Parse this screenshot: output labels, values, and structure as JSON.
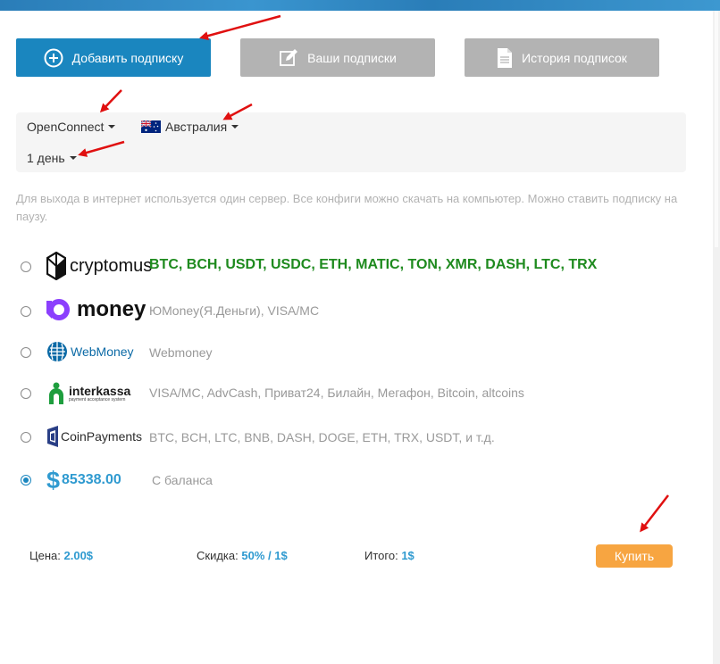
{
  "tabs": {
    "add_label": "Добавить подписку",
    "subs_label": "Ваши подписки",
    "history_label": "История подписок"
  },
  "filters": {
    "protocol": "OpenConnect",
    "country": "Австралия",
    "period": "1 день"
  },
  "info_text": "Для выхода в интернет используется один сервер. Все конфиги можно скачать на компьютер. Можно ставить подписку на паузу.",
  "payment_methods": [
    {
      "logo_text": "cryptomus",
      "description": "BTC, BCH, USDT, USDC, ETH, MATIC, TON, XMR, DASH, LTC, TRX",
      "selected": false
    },
    {
      "logo_text": "money",
      "description": "ЮMoney(Я.Деньги), VISA/MC",
      "selected": false
    },
    {
      "logo_text": "WebMoney",
      "description": "Webmoney",
      "selected": false
    },
    {
      "logo_text": "interkassa",
      "logo_sub": "payment acceptance system",
      "description": "VISA/MC, AdvCash, Приват24, Билайн, Мегафон, Bitcoin, altcoins",
      "selected": false
    },
    {
      "logo_text": "CoinPayments",
      "description": "BTC, BCH, LTC, BNB, DASH, DOGE, ETH, TRX, USDT, и т.д.",
      "selected": false
    },
    {
      "logo_text": "$",
      "balance": "85338.00",
      "description": "С баланса",
      "selected": true
    }
  ],
  "footer": {
    "price_label": "Цена:",
    "price_value": "2.00$",
    "discount_label": "Скидка:",
    "discount_value": "50% / 1$",
    "total_label": "Итого:",
    "total_value": "1$",
    "buy_label": "Купить"
  },
  "colors": {
    "primary": "#1a86bf",
    "inactive_tab": "#b3b3b3",
    "buy": "#f7a541",
    "crypto_text": "#1e8a1e",
    "annotation_arrow": "#e01010"
  }
}
